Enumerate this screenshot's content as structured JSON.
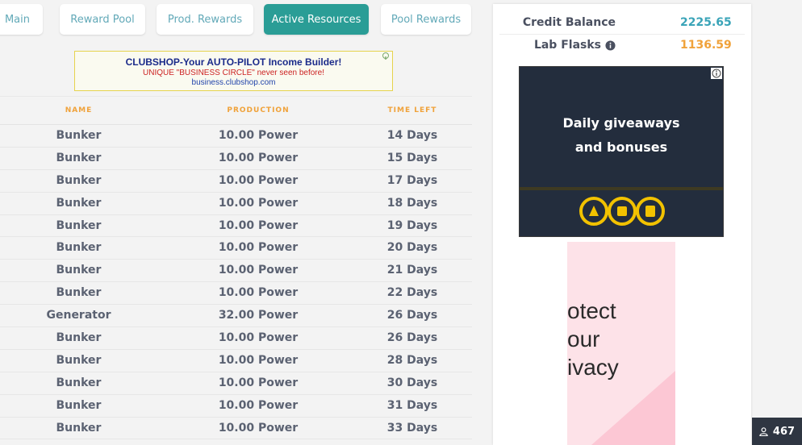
{
  "tabs": [
    "Main",
    "Reward Pool",
    "Prod. Rewards",
    "Active Resources",
    "Pool Rewards"
  ],
  "active_tab": "Active Resources",
  "banner_ad": {
    "line1": "CLUBSHOP-Your AUTO-PILOT Income Builder!",
    "line2": "UNIQUE \"BUSINESS CIRCLE\" never seen before!",
    "line3": "business.clubshop.com"
  },
  "table": {
    "headers": [
      "NAME",
      "PRODUCTION",
      "TIME LEFT"
    ],
    "rows": [
      [
        "Bunker",
        "10.00 Power",
        "14 Days"
      ],
      [
        "Bunker",
        "10.00 Power",
        "15 Days"
      ],
      [
        "Bunker",
        "10.00 Power",
        "17 Days"
      ],
      [
        "Bunker",
        "10.00 Power",
        "18 Days"
      ],
      [
        "Bunker",
        "10.00 Power",
        "19 Days"
      ],
      [
        "Bunker",
        "10.00 Power",
        "20 Days"
      ],
      [
        "Bunker",
        "10.00 Power",
        "21 Days"
      ],
      [
        "Bunker",
        "10.00 Power",
        "22 Days"
      ],
      [
        "Generator",
        "32.00 Power",
        "26 Days"
      ],
      [
        "Bunker",
        "10.00 Power",
        "26 Days"
      ],
      [
        "Bunker",
        "10.00 Power",
        "28 Days"
      ],
      [
        "Bunker",
        "10.00 Power",
        "30 Days"
      ],
      [
        "Bunker",
        "10.00 Power",
        "31 Days"
      ],
      [
        "Bunker",
        "10.00 Power",
        "33 Days"
      ]
    ]
  },
  "balances": {
    "credit_label": "Credit Balance",
    "credit_value": "2225.65",
    "lab_label": "Lab Flasks",
    "lab_value": "1136.59",
    "lab_icon": "info-icon"
  },
  "side_ad": {
    "line1": "Daily giveaways",
    "line2": "and bonuses"
  },
  "pink_ad": {
    "line1": "otect",
    "line2": "our",
    "line3": "ivacy"
  },
  "users_online": {
    "count": "467",
    "icon": "user-icon"
  },
  "colors": {
    "accent": "#2a9d96",
    "tab_text": "#62a9b8",
    "header_orange": "#f0a23a",
    "credit_value": "#3aa4b8",
    "lab_value": "#f0a23a"
  }
}
